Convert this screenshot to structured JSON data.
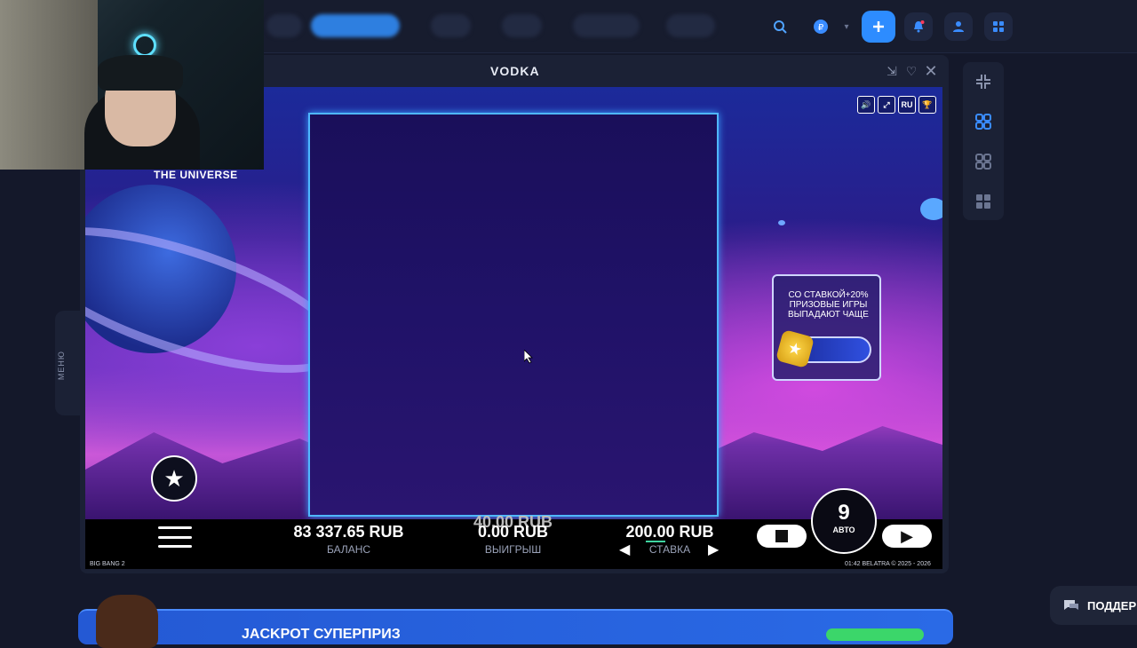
{
  "site": {
    "top_icons": [
      "search-icon",
      "promo-icon",
      "plus-icon",
      "bell-icon",
      "user-icon",
      "grid-icon"
    ]
  },
  "game_window": {
    "title": "VODKA",
    "controls": [
      "minimize-icon",
      "heart-icon",
      "close-icon"
    ]
  },
  "game": {
    "universe_label": "THE UNIVERSE",
    "lang": "RU",
    "promo_text": "СО СТАВКОЙ+20% ПРИЗОВЫЕ ИГРЫ ВЫПАДАЮТ ЧАЩЕ",
    "balance_value": "83 337.65 RUB",
    "balance_label": "БАЛАНС",
    "win_ghost_value": "40.00 RUB",
    "win_value": "0.00 RUB",
    "win_label": "ВЫИГРЫШ",
    "bet_value": "200.00 RUB",
    "bet_label": "СТАВКА",
    "auto_count": "9",
    "auto_label": "АВТО",
    "game_name": "BIG BANG 2",
    "footer_right": "01:42  BELATRA © 2025 - 2026"
  },
  "side": {
    "menu_label": "МЕНЮ"
  },
  "banner": {
    "title": "JACKPOT СУПЕРПРИЗ"
  },
  "support": {
    "label": "ПОДДЕР"
  },
  "colors": {
    "accent": "#2d8cff",
    "panel": "#1b2135",
    "background": "#14182a"
  }
}
